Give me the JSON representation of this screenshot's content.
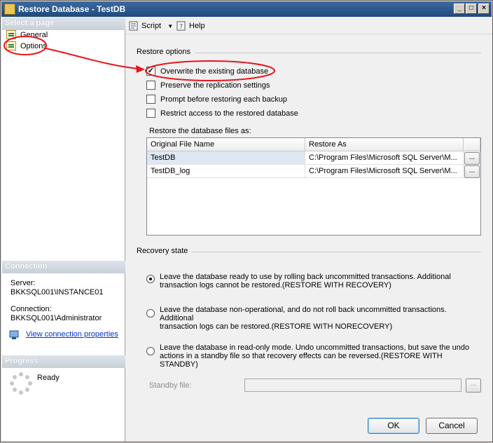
{
  "window": {
    "title": "Restore Database - TestDB"
  },
  "sidebar": {
    "select_page_header": "Select a page",
    "pages": [
      {
        "label": "General"
      },
      {
        "label": "Options"
      }
    ],
    "connection_header": "Connection",
    "server_label": "Server:",
    "server_value": "BKKSQL001\\INSTANCE01",
    "connection_label": "Connection:",
    "connection_value": "BKKSQL001\\Administrator",
    "view_connection_link": "View connection properties",
    "progress_header": "Progress",
    "progress_status": "Ready"
  },
  "toolbar": {
    "script_label": "Script",
    "help_label": "Help"
  },
  "restore_options": {
    "group_label": "Restore options",
    "checkboxes": [
      {
        "label": "Overwrite the existing database",
        "checked": true
      },
      {
        "label": "Preserve the replication settings",
        "checked": false
      },
      {
        "label": "Prompt before restoring each backup",
        "checked": false
      },
      {
        "label": "Restrict access to the restored database",
        "checked": false
      }
    ]
  },
  "files": {
    "label": "Restore the database files as:",
    "columns": [
      "Original File Name",
      "Restore As"
    ],
    "rows": [
      {
        "original": "TestDB",
        "restore_as": "C:\\Program Files\\Microsoft SQL Server\\M..."
      },
      {
        "original": "TestDB_log",
        "restore_as": "C:\\Program Files\\Microsoft SQL Server\\M..."
      }
    ],
    "browse_label": "..."
  },
  "recovery": {
    "group_label": "Recovery state",
    "options": [
      {
        "line1": "Leave the database ready to use by rolling back uncommitted transactions. Additional",
        "line2": "transaction logs cannot be restored.(RESTORE WITH RECOVERY)",
        "selected": true
      },
      {
        "line1": "Leave the database non-operational, and do not roll back uncommitted transactions. Additional",
        "line2": "transaction logs can be restored.(RESTORE WITH NORECOVERY)",
        "selected": false
      },
      {
        "line1": "Leave the database in read-only mode. Undo uncommitted transactions, but save the undo",
        "line2": "actions in a standby file so that recovery effects can be reversed.(RESTORE WITH STANDBY)",
        "selected": false
      }
    ],
    "standby_label": "Standby file:",
    "standby_value": "",
    "standby_browse": "..."
  },
  "buttons": {
    "ok": "OK",
    "cancel": "Cancel"
  },
  "colors": {
    "annotation": "#e8141c",
    "title_bar": "#2a5587",
    "link": "#0033cc"
  }
}
